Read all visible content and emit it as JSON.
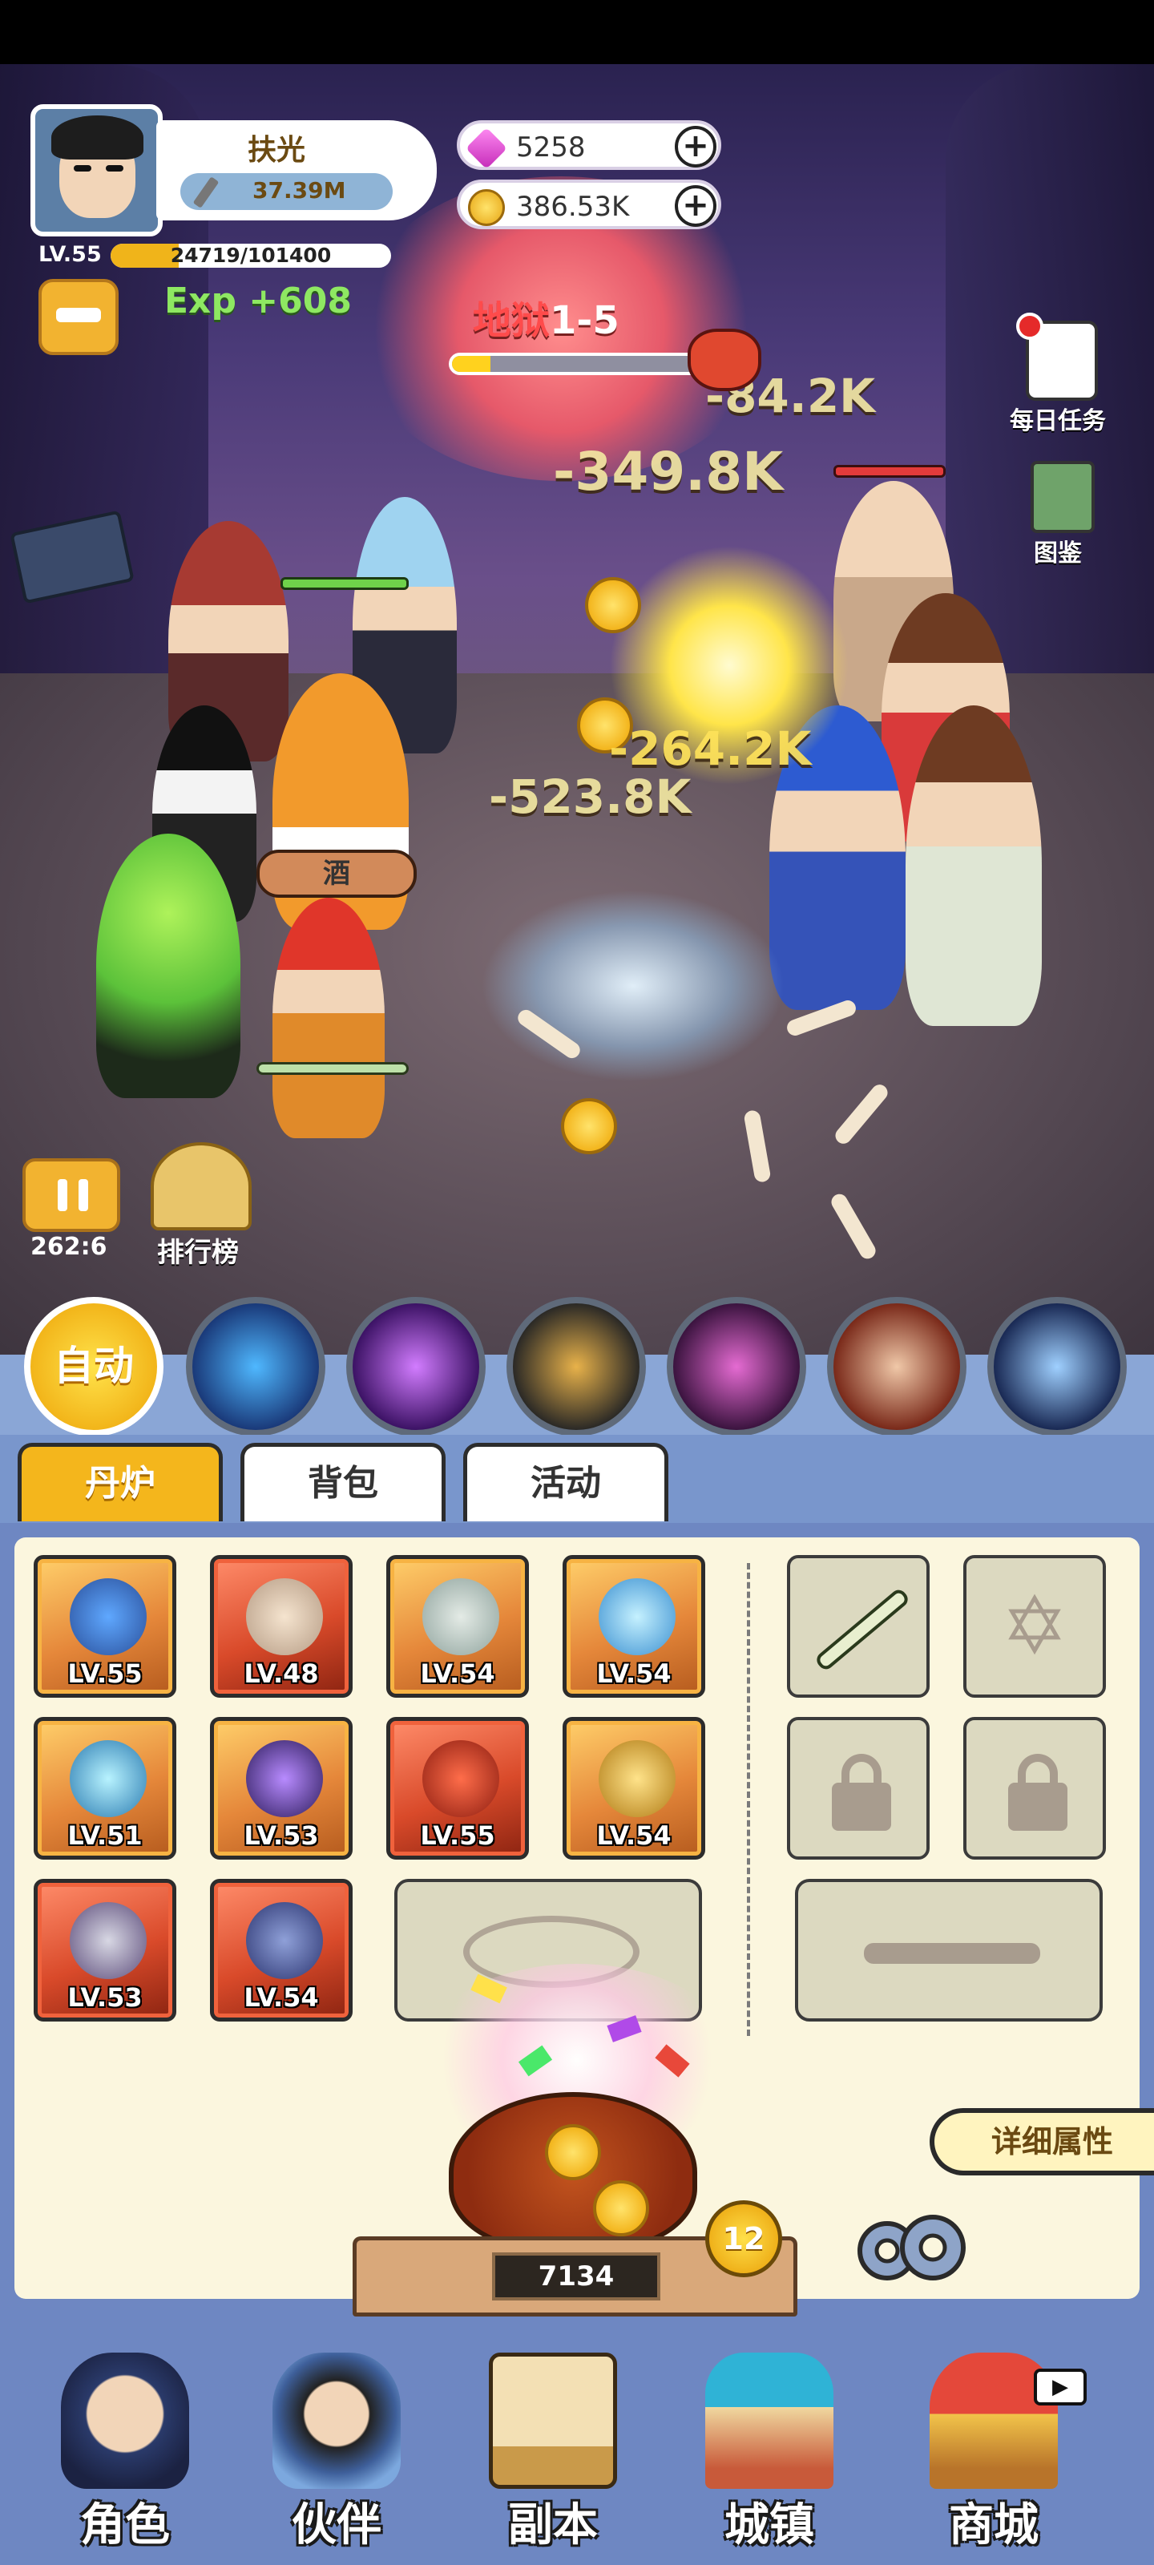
{
  "player": {
    "name": "扶光",
    "power": "37.39M",
    "level": "LV.55",
    "xp": "24719/101400",
    "xp_fraction": 0.244,
    "exp_gain": "Exp +608"
  },
  "currencies": {
    "gems": "5258",
    "gold": "386.53K",
    "plus": "+"
  },
  "stage": {
    "prefix": "地狱",
    "number": "1-5",
    "progress_fraction": 0.15
  },
  "side_buttons": {
    "daily_tasks": "每日任务",
    "codex": "图鉴"
  },
  "damage_numbers": [
    "-84.2K",
    "-349.8K",
    "-264.2K",
    "-523.8K"
  ],
  "battle": {
    "pause_symbol": "II",
    "timer": "262:6",
    "ranking": "排行榜",
    "bottle_label": "酒"
  },
  "skills": {
    "auto_label": "自动",
    "icons": [
      "blue-flame-skill-icon",
      "purple-vortex-skill-icon",
      "lightning-pillar-skill-icon",
      "violet-strike-skill-icon",
      "beast-roar-skill-icon",
      "ice-rune-skill-icon"
    ]
  },
  "tabs": [
    {
      "label": "丹炉",
      "active": true
    },
    {
      "label": "背包",
      "active": false
    },
    {
      "label": "活动",
      "active": false
    }
  ],
  "equipment": [
    {
      "name": "trident-icon",
      "level": "LV.55",
      "rarity": "orange"
    },
    {
      "name": "horned-helmet-icon",
      "level": "LV.48",
      "rarity": "red"
    },
    {
      "name": "armor-icon",
      "level": "LV.54",
      "rarity": "orange"
    },
    {
      "name": "orb-icon",
      "level": "LV.54",
      "rarity": "orange"
    },
    {
      "name": "spirit-flame-icon",
      "level": "LV.51",
      "rarity": "orange"
    },
    {
      "name": "dark-orb-icon",
      "level": "LV.53",
      "rarity": "orange"
    },
    {
      "name": "demon-mask-icon",
      "level": "LV.55",
      "rarity": "red"
    },
    {
      "name": "golden-relic-icon",
      "level": "LV.54",
      "rarity": "orange"
    },
    {
      "name": "skull-bracer-icon",
      "level": "LV.53",
      "rarity": "red"
    },
    {
      "name": "boots-icon",
      "level": "LV.54",
      "rarity": "red"
    }
  ],
  "furnace": {
    "count": "7134",
    "level": "12",
    "detail_button": "详细属性"
  },
  "nav": [
    {
      "label": "角色",
      "icon": "character-icon"
    },
    {
      "label": "伙伴",
      "icon": "partner-icon"
    },
    {
      "label": "副本",
      "icon": "dungeon-icon"
    },
    {
      "label": "城镇",
      "icon": "town-icon"
    },
    {
      "label": "商城",
      "icon": "shop-icon"
    }
  ],
  "colors": {
    "gold_accent": "#f4b61c",
    "panel_bg": "#fbf6de",
    "nav_bg": "#6e87c2",
    "exp_green": "#8ee862"
  }
}
